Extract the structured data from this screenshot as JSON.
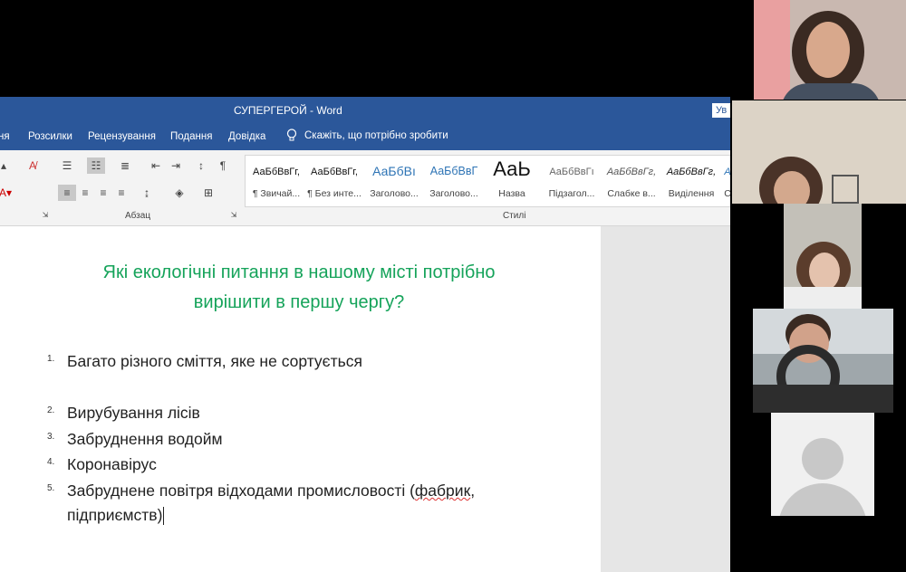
{
  "window": {
    "title": "СУПЕРГЕРОЙ  -  Word",
    "user_btn": "Ув"
  },
  "menu": [
    "ня",
    "Розсилки",
    "Рецензування",
    "Подання",
    "Довідка"
  ],
  "tell_me": "Скажіть, що потрібно зробити",
  "ribbon": {
    "paragraph_group": "Абзац",
    "styles_group": "Стилі",
    "pilcrow": "¶",
    "styles": [
      {
        "sample": "АаБбВвГг,",
        "name": "¶ Звичай..."
      },
      {
        "sample": "АаБбВвГг,",
        "name": "¶ Без инте..."
      },
      {
        "sample": "АаБбВı",
        "name": "Заголово..."
      },
      {
        "sample": "АаБбВвГ",
        "name": "Заголово..."
      },
      {
        "sample": "АаЬ",
        "name": "Назва"
      },
      {
        "sample": "АаБбВвГı",
        "name": "Підзагол..."
      },
      {
        "sample": "АаБбВвГг,",
        "name": "Слабке в..."
      },
      {
        "sample": "АаБбВвГг,",
        "name": "Виділення"
      },
      {
        "sample": "А",
        "name": "С"
      }
    ]
  },
  "document": {
    "heading_line1": "Які екологічні питання в нашому місті потрібно",
    "heading_line2": "вирішити в першу чергу?",
    "items": [
      {
        "num": "1.",
        "text": "Багато різного сміття, яке не сортується"
      },
      {
        "num": "2.",
        "text": "Вирубування лісів"
      },
      {
        "num": "3.",
        "text": "Забруднення водойм"
      },
      {
        "num": "4.",
        "text": "Коронавірус"
      },
      {
        "num": "5.",
        "text_a": "Забруднене повітря відходами промисловості (",
        "text_b": "фабрик",
        "text_c": ",",
        "text_line2": "підприємств)"
      }
    ]
  },
  "colors": {
    "word_blue": "#2b579a",
    "heading_green": "#15a35a"
  }
}
